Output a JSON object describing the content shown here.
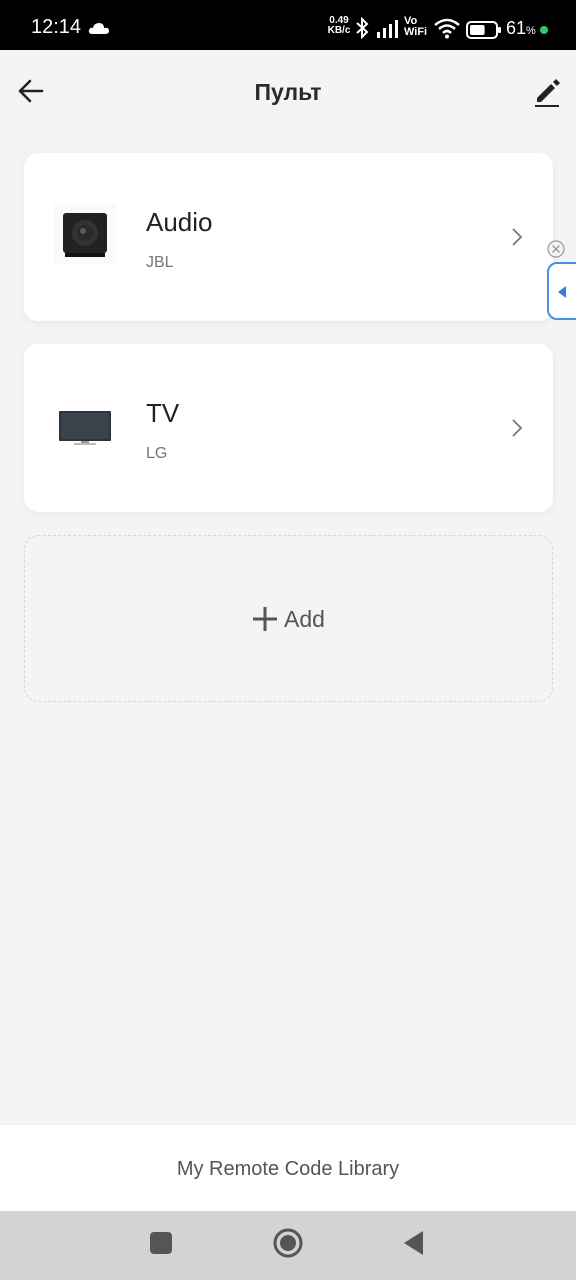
{
  "status_bar": {
    "time": "12:14",
    "speed_value": "0.49",
    "speed_unit": "KB/c",
    "vo": "Vo",
    "wifi_label": "WiFi",
    "battery_percent": "61",
    "battery_unit": "%",
    "battery_level": 0.61,
    "icons": [
      "cloud-icon",
      "bluetooth-icon",
      "signal-icon",
      "wifi-icon",
      "battery-icon"
    ]
  },
  "header": {
    "title": "Пульт",
    "back_icon": "arrow-left-icon",
    "edit_icon": "pencil-icon"
  },
  "devices": [
    {
      "name": "Audio",
      "brand": "JBL",
      "icon": "speaker-icon"
    },
    {
      "name": "TV",
      "brand": "LG",
      "icon": "tv-icon"
    }
  ],
  "add_button": {
    "label": "Add",
    "icon": "plus-icon"
  },
  "footer": {
    "link_label": "My Remote Code Library"
  },
  "colors": {
    "accent": "#4a8fe7",
    "background": "#f4f4f4",
    "card": "#ffffff",
    "charging": "#2ecc71"
  }
}
